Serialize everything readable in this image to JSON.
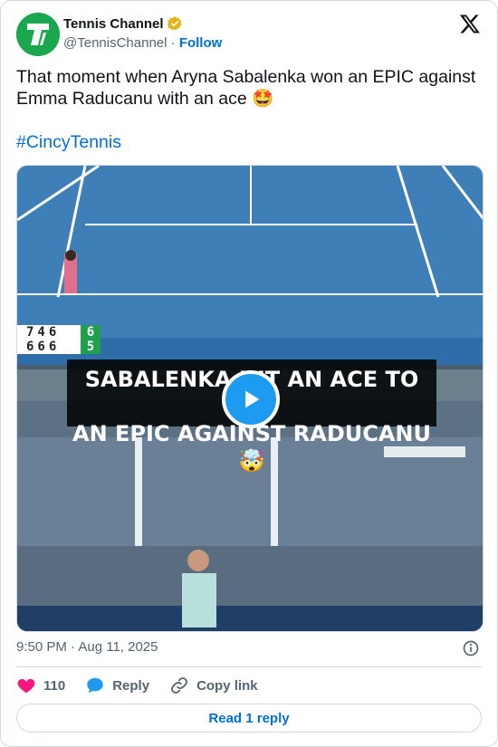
{
  "author": {
    "display_name": "Tennis Channel",
    "handle": "@TennisChannel",
    "separator": "·",
    "follow_label": "Follow"
  },
  "tweet": {
    "text": "That moment when Aryna Sabalenka won an EPIC against Emma Raducanu with an ace 🤩",
    "hashtag": "#CincyTennis"
  },
  "media": {
    "caption_line1": "SABALENKA HIT AN ACE TO WIN",
    "caption_line2": "AN EPIC AGAINST RADUCANU 🤯",
    "score_row1": "746",
    "score_row2": "666",
    "score_cur1": "6",
    "score_cur2": "5"
  },
  "meta": {
    "timestamp": "9:50 PM · Aug 11, 2025"
  },
  "actions": {
    "like_count": "110",
    "reply_label": "Reply",
    "copy_label": "Copy link"
  },
  "read_reply_label": "Read 1 reply",
  "colors": {
    "brand": "#1aa74d",
    "link": "#006fd6",
    "like": "#f91880",
    "play": "#1d9bf0"
  }
}
